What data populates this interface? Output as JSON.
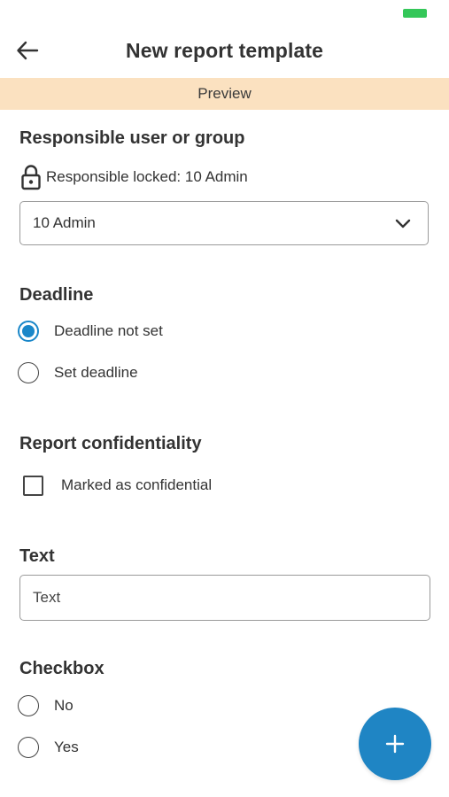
{
  "status_bar": {
    "battery_color": "#34c759"
  },
  "header": {
    "title": "New report template",
    "back_icon": "arrow-left-icon"
  },
  "banner": {
    "text": "Preview",
    "color": "#fbe1c0"
  },
  "responsible": {
    "title": "Responsible user or group",
    "lock_icon": "lock-icon",
    "lock_text": "Responsible locked: 10 Admin",
    "selected_value": "10 Admin",
    "dropdown_icon": "chevron-down-icon"
  },
  "deadline": {
    "title": "Deadline",
    "options": [
      {
        "label": "Deadline not set",
        "checked": true
      },
      {
        "label": "Set deadline",
        "checked": false
      }
    ]
  },
  "confidentiality": {
    "title": "Report confidentiality",
    "checkbox_label": "Marked as confidential",
    "checked": false
  },
  "text_field": {
    "title": "Text",
    "placeholder": "Text",
    "value": ""
  },
  "checkbox_field": {
    "title": "Checkbox",
    "options": [
      {
        "label": "No",
        "checked": false
      },
      {
        "label": "Yes",
        "checked": false
      }
    ]
  },
  "fab": {
    "icon": "plus-icon",
    "color": "#1f85c4"
  },
  "accent_color": "#1a87c9"
}
